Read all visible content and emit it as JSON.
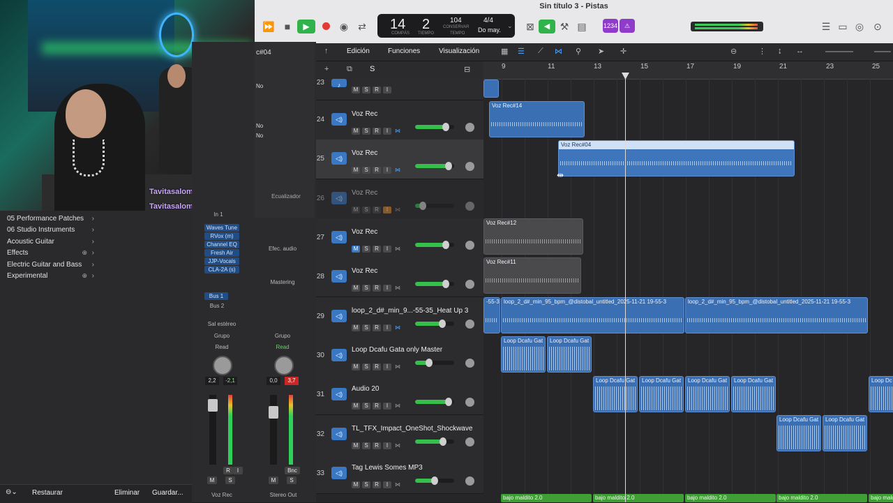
{
  "window_title": "Sin título 3 - Pistas",
  "lcd": {
    "bar": "14",
    "beat": "2",
    "bar_label": "COMPÁS",
    "beat_label": "TIEMPO",
    "tempo": "104",
    "tempo_label": "CONSERVAR",
    "tempo_sub": "TEMPO",
    "signature": "4/4",
    "key": "Do may."
  },
  "toolbar": {
    "count_in": "1234"
  },
  "chat": [
    {
      "user": "Tavitasalome :"
    },
    {
      "user": "Tavitasalome :"
    }
  ],
  "library": {
    "items": [
      {
        "label": "05 Performance Patches",
        "add": false
      },
      {
        "label": "06 Studio Instruments",
        "add": false
      },
      {
        "label": "Acoustic Guitar",
        "add": false
      },
      {
        "label": "Effects",
        "add": true
      },
      {
        "label": "Electric Guitar and Bass",
        "add": false
      },
      {
        "label": "Experimental",
        "add": true
      }
    ],
    "footer": {
      "restore": "Restaurar",
      "delete": "Eliminar",
      "save": "Guardar..."
    }
  },
  "inspector": {
    "region_name": "c#04",
    "no1": "No",
    "no2": "No",
    "no3": "No",
    "eq": "Ecualizador",
    "strip1": {
      "input": "In 1",
      "plugins": [
        "Waves Tune",
        "RVox (m)",
        "Channel EQ",
        "Fresh Air",
        "JJP-Vocals",
        "CLA-2A (s)"
      ],
      "sends": [
        "Bus 1",
        "Bus 2"
      ],
      "output": "Sal estéreo",
      "group": "Grupo",
      "automation": "Read",
      "pan": "2,2",
      "peak": "-2,1",
      "r": "R",
      "i": "I",
      "m": "M",
      "s": "S",
      "name": "Voz Rec"
    },
    "strip2": {
      "effects": "Efec. audio",
      "mastering": "Mastering",
      "group": "Grupo",
      "automation": "Read",
      "pan": "0,0",
      "peak": "3,7",
      "bnc": "Bnc",
      "m": "M",
      "s": "S",
      "name": "Stereo Out"
    }
  },
  "edit_menus": {
    "edit": "Edición",
    "functions": "Funciones",
    "view": "Visualización"
  },
  "track_tools": {
    "s": "S"
  },
  "ruler": {
    "bars": [
      "9",
      "11",
      "13",
      "15",
      "17",
      "19",
      "21",
      "23",
      "25"
    ]
  },
  "tracks": [
    {
      "no": "24",
      "name": "Voz Rec",
      "volume": 0.78,
      "mute": false,
      "rec": false
    },
    {
      "no": "25",
      "name": "Voz Rec",
      "volume": 0.85,
      "mute": false,
      "rec": false
    },
    {
      "no": "26",
      "name": "Voz Rec",
      "volume": 0.2,
      "mute": false,
      "rec": true
    },
    {
      "no": "27",
      "name": "Voz Rec",
      "volume": 0.78,
      "mute": true,
      "rec": false
    },
    {
      "no": "28",
      "name": "Voz Rec",
      "volume": 0.78,
      "mute": false,
      "rec": false
    },
    {
      "no": "29",
      "name": "loop_2_d#_min_9...-55-35_Heat Up 3",
      "volume": 0.7,
      "mute": false,
      "rec": false
    },
    {
      "no": "30",
      "name": "Loop Dcafu Gata only Master",
      "volume": 0.35,
      "mute": false,
      "rec": false
    },
    {
      "no": "31",
      "name": "Audio 20",
      "volume": 0.85,
      "mute": false,
      "rec": false
    },
    {
      "no": "32",
      "name": "TL_TFX_Impact_OneShot_Shockwave",
      "volume": 0.72,
      "mute": false,
      "rec": false
    },
    {
      "no": "33",
      "name": "Tag Lewis Somes MP3",
      "volume": 0.5,
      "mute": false,
      "rec": false
    }
  ],
  "track_partial": {
    "no": "23"
  },
  "regions": {
    "r14": "Voz Rec#14",
    "r04": "Voz Rec#04",
    "r12": "Voz Rec#12",
    "r11": "Voz Rec#11",
    "loop_a": "-55-3",
    "loop_b": "loop_2_d#_min_95_bpm_@distobal_untitled_2025-11-21 19-55-3",
    "loop_c": "loop_2_d#_min_95_bpm_@distobal_untitled_2025-11-21 19-55-3",
    "gata": "Loop Dcafu Gat",
    "gata_full": "Loop Dcafu Gata",
    "gata_short": "Loop Dc",
    "bajo": "bajo maldito 2.0"
  },
  "colors": {
    "accent_blue": "#3a6fb3",
    "play_green": "#2fb34a",
    "record_red": "#e53935",
    "purple": "#8e3cc9"
  }
}
